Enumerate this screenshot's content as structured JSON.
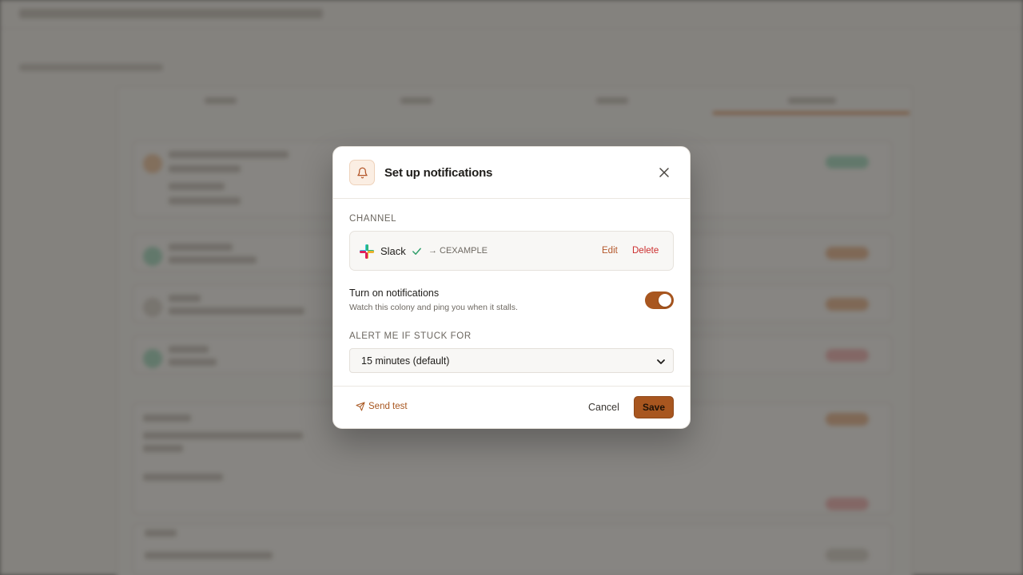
{
  "modal": {
    "title": "Set up notifications",
    "icon": "bell-icon",
    "close_icon": "close-icon"
  },
  "channel": {
    "section_label": "CHANNEL",
    "provider": "Slack",
    "provider_icon": "slack-logo",
    "status_icon": "check-icon",
    "target": "CEXAMPLE",
    "edit_label": "Edit",
    "delete_label": "Delete"
  },
  "notifications": {
    "title": "Turn on notifications",
    "description": "Watch this colony and ping you when it stalls.",
    "enabled": true
  },
  "alert": {
    "section_label": "ALERT ME IF STUCK FOR",
    "selected": "15 minutes (default)"
  },
  "footer": {
    "send_test_label": "Send test",
    "cancel_label": "Cancel",
    "save_label": "Save"
  },
  "colors": {
    "accent": "#a8561f",
    "danger": "#cc2e2e",
    "success": "#2f9e6a"
  }
}
